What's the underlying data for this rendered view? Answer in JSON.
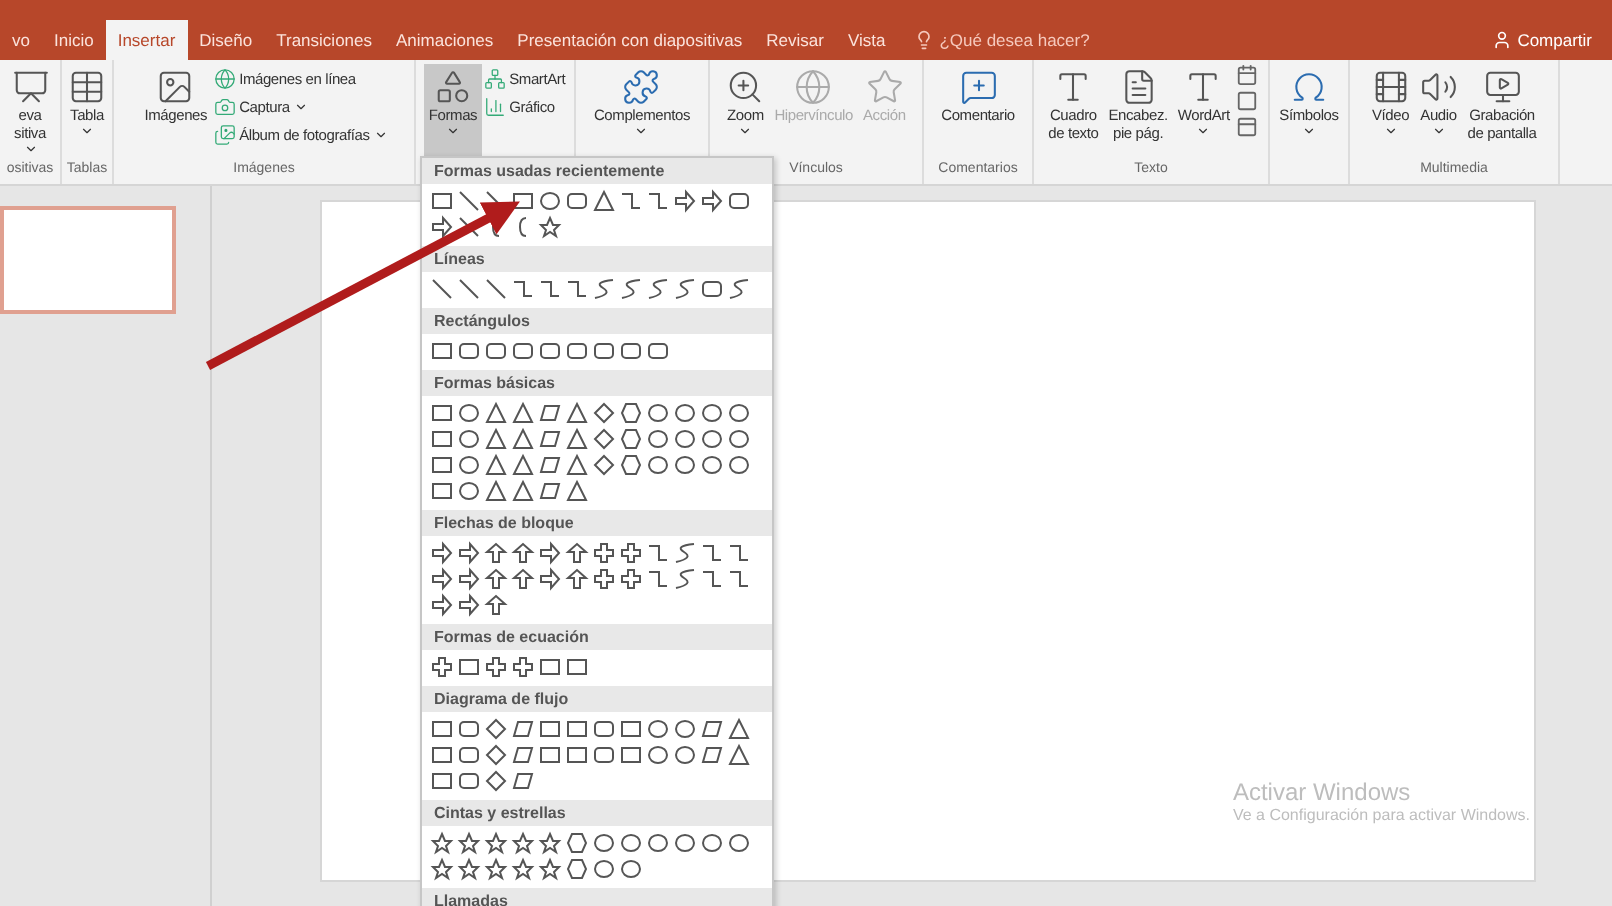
{
  "tabs": [
    {
      "label": "vo",
      "selected": false
    },
    {
      "label": "Inicio",
      "selected": false
    },
    {
      "label": "Insertar",
      "selected": true
    },
    {
      "label": "Diseño",
      "selected": false
    },
    {
      "label": "Transiciones",
      "selected": false
    },
    {
      "label": "Animaciones",
      "selected": false
    },
    {
      "label": "Presentación con diapositivas",
      "selected": false
    },
    {
      "label": "Revisar",
      "selected": false
    },
    {
      "label": "Vista",
      "selected": false
    }
  ],
  "tell_me": "¿Qué desea hacer?",
  "share": "Compartir",
  "ribbon_groups": [
    {
      "label": "ositivas",
      "buttons": [
        {
          "kind": "large",
          "label": "eva\nsitiva",
          "menu": true,
          "disabled": false,
          "pressed": false
        }
      ]
    },
    {
      "label": "Tablas",
      "buttons": [
        {
          "kind": "large",
          "label": "Tabla",
          "menu": true,
          "disabled": false,
          "pressed": false
        }
      ]
    },
    {
      "label": "Imágenes",
      "buttons": [
        {
          "kind": "large",
          "label": "Imágenes",
          "menu": false,
          "disabled": false,
          "pressed": false
        },
        {
          "kind": "small",
          "label": "Imágenes en línea",
          "menu": false,
          "disabled": false,
          "pressed": false
        },
        {
          "kind": "small",
          "label": "Captura",
          "menu": true,
          "disabled": false,
          "pressed": false
        },
        {
          "kind": "small",
          "label": "Álbum de fotografías",
          "menu": true,
          "disabled": false,
          "pressed": false
        }
      ]
    },
    {
      "buttons": [
        {
          "kind": "large",
          "label": "Formas",
          "menu": true,
          "disabled": false,
          "pressed": true
        },
        {
          "kind": "small",
          "label": "SmartArt",
          "menu": false,
          "disabled": false,
          "pressed": false
        },
        {
          "kind": "small",
          "label": "Gráfico",
          "menu": false,
          "disabled": false,
          "pressed": false
        }
      ]
    },
    {
      "buttons": [
        {
          "kind": "large",
          "label": "Complementos",
          "menu": true,
          "disabled": false,
          "pressed": false
        }
      ]
    },
    {
      "label": "Vínculos",
      "buttons": [
        {
          "kind": "large",
          "label": "Zoom",
          "menu": true,
          "disabled": false,
          "pressed": false
        },
        {
          "kind": "large",
          "label": "Hipervínculo",
          "menu": false,
          "disabled": true,
          "pressed": false
        },
        {
          "kind": "large",
          "label": "Acción",
          "menu": false,
          "disabled": true,
          "pressed": false
        }
      ]
    },
    {
      "label": "Comentarios",
      "buttons": [
        {
          "kind": "large",
          "label": "Comentario",
          "menu": false,
          "disabled": false,
          "pressed": false
        }
      ]
    },
    {
      "label": "Texto",
      "buttons": [
        {
          "kind": "large",
          "label": "Cuadro\nde texto",
          "menu": false,
          "disabled": false,
          "pressed": false
        },
        {
          "kind": "large",
          "label": "Encabez.\npie pág.",
          "menu": false,
          "disabled": false,
          "pressed": false
        },
        {
          "kind": "large",
          "label": "WordArt",
          "menu": true,
          "disabled": false,
          "pressed": false
        }
      ],
      "icon_stack": true
    },
    {
      "buttons": [
        {
          "kind": "large",
          "label": "Símbolos",
          "menu": true,
          "disabled": false,
          "pressed": false
        }
      ]
    },
    {
      "label": "Multimedia",
      "buttons": [
        {
          "kind": "large",
          "label": "Vídeo",
          "menu": true,
          "disabled": false,
          "pressed": false
        },
        {
          "kind": "large",
          "label": "Audio",
          "menu": true,
          "disabled": false,
          "pressed": false
        },
        {
          "kind": "large",
          "label": "Grabación\nde pantalla",
          "menu": false,
          "disabled": false,
          "pressed": false
        }
      ]
    }
  ],
  "shapes_menu": [
    {
      "title": "Formas usadas recientemente",
      "kind": "recent"
    },
    {
      "title": "Líneas",
      "kind": "lines"
    },
    {
      "title": "Rectángulos",
      "kind": "rectangles"
    },
    {
      "title": "Formas básicas",
      "kind": "basic"
    },
    {
      "title": "Flechas de bloque",
      "kind": "arrows"
    },
    {
      "title": "Formas de ecuación",
      "kind": "equation"
    },
    {
      "title": "Diagrama de flujo",
      "kind": "flowchart"
    },
    {
      "title": "Cintas y estrellas",
      "kind": "stars"
    },
    {
      "title": "Llamadas",
      "kind": "callouts"
    }
  ],
  "thumbnails": [
    {
      "selected": true
    }
  ],
  "activation": {
    "title": "Activar Windows",
    "subtitle": "Ve a Configuración para activar Windows."
  }
}
